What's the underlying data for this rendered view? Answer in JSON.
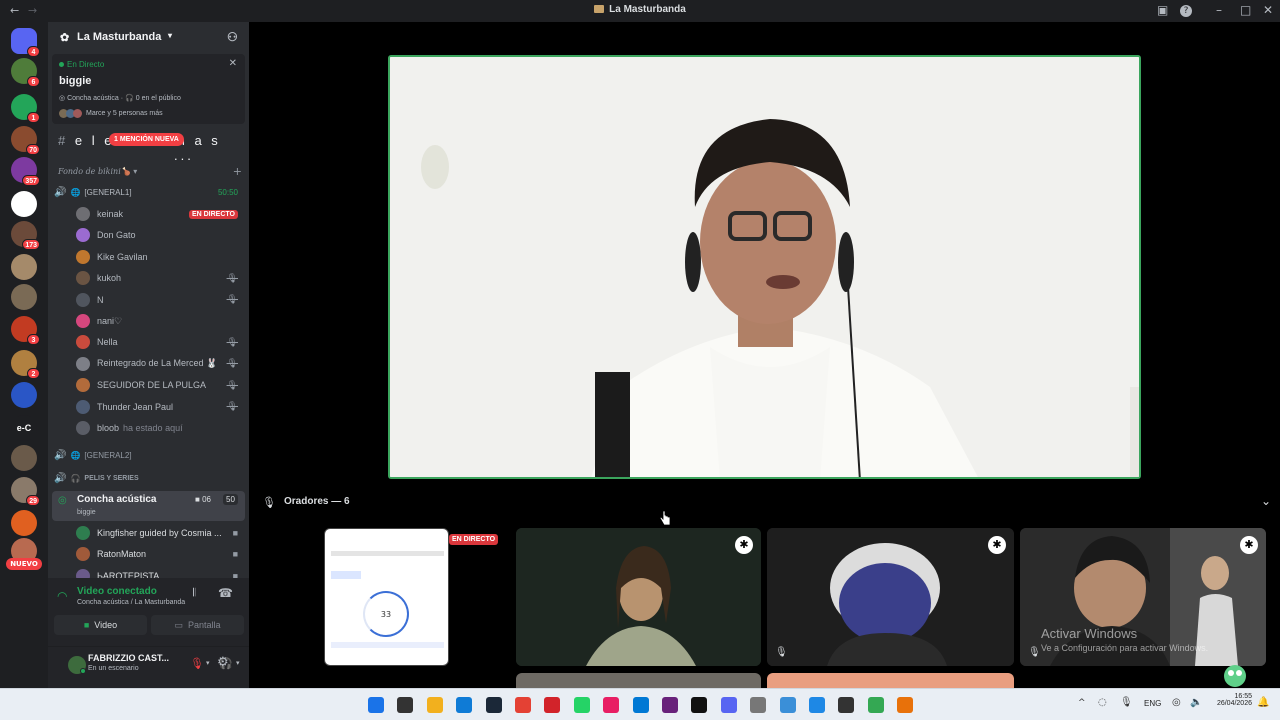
{
  "window": {
    "title": "La Masturbanda"
  },
  "rail": {
    "servers": [
      {
        "badge": "4",
        "color": "#5865f2",
        "label": ""
      },
      {
        "badge": "6",
        "color": "#4f7c3a",
        "label": ""
      },
      {
        "badge": "1",
        "color": "#23a559",
        "label": ""
      },
      {
        "badge": "70",
        "color": "#8a4b2f",
        "label": ""
      },
      {
        "badge": "357",
        "color": "#7d3aa0",
        "label": ""
      },
      {
        "badge": "",
        "color": "#ffffff",
        "label": ""
      },
      {
        "badge": "173",
        "color": "#6b4a3a",
        "label": ""
      },
      {
        "badge": "",
        "color": "#a58a6a",
        "label": ""
      },
      {
        "badge": "",
        "color": "#7a6a55",
        "label": ""
      },
      {
        "badge": "3",
        "color": "#c23b22",
        "label": ""
      },
      {
        "badge": "2",
        "color": "#b08040",
        "label": ""
      },
      {
        "badge": "",
        "color": "#2a56c6",
        "label": ""
      },
      {
        "badge": "",
        "color": "#1e1f22",
        "label": "e-C"
      },
      {
        "badge": "",
        "color": "#6a5a4a",
        "label": ""
      },
      {
        "badge": "29",
        "color": "#8a7a6a",
        "label": ""
      },
      {
        "badge": "",
        "color": "#e06020",
        "label": ""
      },
      {
        "badge": "",
        "color": "#b86a50",
        "label": ""
      }
    ],
    "new_label": "NUEVO"
  },
  "guild": {
    "name": "La Masturbanda"
  },
  "live_card": {
    "status": "En Directo",
    "name": "biggie",
    "channel": "Concha acústica",
    "audience": "0 en el público",
    "others": "Marce y 5 personas más"
  },
  "text_channel": {
    "name": "e l e",
    "name_tail": "m a s ...",
    "mention": "1 MENCIÓN NUEVA"
  },
  "category": {
    "name": "Fondo de bikini🍗"
  },
  "voice_general1": {
    "name": "[GENERAL1]",
    "time": "50:50"
  },
  "members": [
    {
      "name": "keinak",
      "live": "EN DIRECTO",
      "muted": false,
      "color": "#6e6e73"
    },
    {
      "name": "Don Gato",
      "live": "",
      "muted": false,
      "color": "#9b6bd1"
    },
    {
      "name": "Kike Gavilan",
      "live": "",
      "muted": false,
      "color": "#c0772e"
    },
    {
      "name": "kukoh",
      "live": "",
      "muted": true,
      "color": "#6a5443"
    },
    {
      "name": "N",
      "live": "",
      "muted": true,
      "color": "#50555e"
    },
    {
      "name": "nani♡",
      "live": "",
      "muted": false,
      "color": "#d6477e"
    },
    {
      "name": "Nella",
      "live": "",
      "muted": true,
      "color": "#c94b3d"
    },
    {
      "name": "Reintegrado de La Merced 🐰",
      "live": "",
      "muted": true,
      "color": "#7d7f87"
    },
    {
      "name": "SEGUIDOR DE LA PULGA",
      "live": "",
      "muted": true,
      "color": "#b26b3b"
    },
    {
      "name": "Thunder Jean Paul",
      "live": "",
      "muted": true,
      "color": "#4d5b73"
    },
    {
      "name": "bloob",
      "suffix": "ha estado aquí",
      "live": "",
      "muted": false,
      "color": "#5a5d66"
    }
  ],
  "voice_general2": {
    "name": "[GENERAL2]"
  },
  "voice_pelis": {
    "name": "PELIS Y SERIES"
  },
  "stage_channel": {
    "name": "Concha acústica",
    "sub": "biggie",
    "cams": "06",
    "count": "50"
  },
  "stage_members": [
    {
      "name": "Kingfisher guided by Cosmia ...",
      "color": "#2e7d4f"
    },
    {
      "name": "RatonMaton",
      "color": "#a05a3a"
    },
    {
      "name": "ЬAROTEPISTA",
      "color": "#6a5a8a"
    }
  ],
  "voice_panel": {
    "status": "Video conectado",
    "location": "Concha acústica / La Masturbanda",
    "video_btn": "Video",
    "screen_btn": "Pantalla"
  },
  "user": {
    "name": "FABRIZZIO CAST...",
    "status": "En un escenario"
  },
  "stage": {
    "speakers_label": "Oradores — 6",
    "live_tag": "EN DIRECTO",
    "screen_number": "33",
    "watermark_title": "Activar Windows",
    "watermark_sub": "Ve a Configuración para activar Windows."
  },
  "taskbar": {
    "lang": "ENG",
    "time": "16:55",
    "date": "26/04/2026",
    "icons": [
      "windows-start-icon",
      "search-icon",
      "file-explorer-icon",
      "edge-icon",
      "steam-icon",
      "chrome-icon",
      "opera-icon",
      "whatsapp-icon",
      "intellij-icon",
      "vscode-icon",
      "visual-studio-icon",
      "tiktok-icon",
      "discord-icon",
      "settings-icon",
      "notepad-icon",
      "edge-dev-icon",
      "terminal-icon",
      "chrome-beta-icon",
      "chrome-canary-icon"
    ]
  },
  "colors": {
    "accent": "#5865f2",
    "live": "#da373c",
    "green": "#3ba55d",
    "bg_dark": "#1e1f22",
    "sidebar": "#2b2d31"
  }
}
